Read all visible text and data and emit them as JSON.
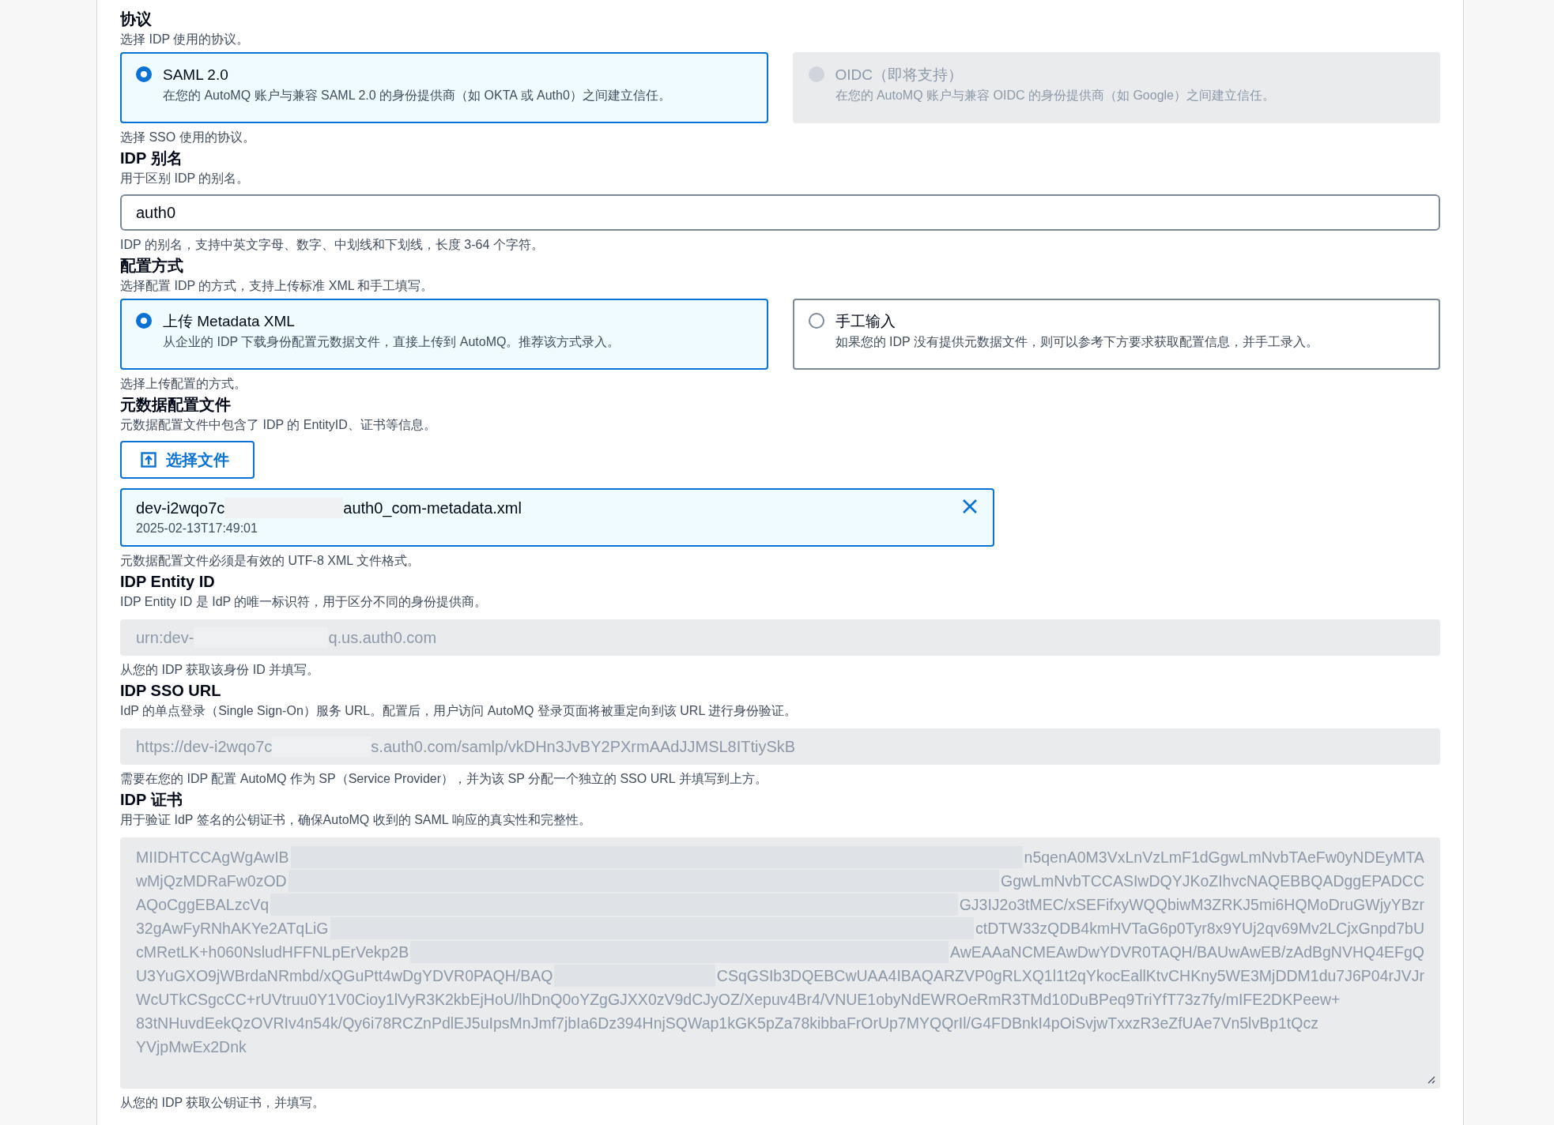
{
  "sections": [
    {
      "kind": "radio",
      "title": "协议",
      "description": "选择 IDP 使用的协议。",
      "options": [
        {
          "label": "SAML 2.0",
          "detail": "在您的 AutoMQ 账户与兼容 SAML 2.0 的身份提供商（如 OKTA 或 Auth0）之间建立信任。",
          "selected": true,
          "disabled": false
        },
        {
          "label": "OIDC（即将支持）",
          "detail": "在您的 AutoMQ 账户与兼容 OIDC 的身份提供商（如 Google）之间建立信任。",
          "selected": false,
          "disabled": true
        }
      ],
      "hint": "选择 SSO 使用的协议。"
    },
    {
      "kind": "input",
      "title": "IDP 别名",
      "description": "用于区别 IDP 的别名。",
      "value": "auth0",
      "hint": "IDP 的别名，支持中英文字母、数字、中划线和下划线，长度 3-64 个字符。"
    },
    {
      "kind": "radio",
      "title": "配置方式",
      "description": "选择配置 IDP 的方式，支持上传标准 XML 和手工填写。",
      "options": [
        {
          "label": "上传 Metadata XML",
          "detail": "从企业的 IDP 下载身份配置元数据文件，直接上传到 AutoMQ。推荐该方式录入。",
          "selected": true,
          "disabled": false
        },
        {
          "label": "手工输入",
          "detail": "如果您的 IDP 没有提供元数据文件，则可以参考下方要求获取配置信息，并手工录入。",
          "selected": false,
          "disabled": false
        }
      ],
      "hint": "选择上传配置的方式。"
    },
    {
      "kind": "file",
      "title": "元数据配置文件",
      "description": "元数据配置文件中包含了 IDP 的 EntityID、证书等信息。",
      "button": "选择文件",
      "file": {
        "before": "dev-i2wqo7c",
        "after": "auth0_com-metadata.xml",
        "date": "2025-02-13T17:49:01"
      },
      "hint": "元数据配置文件必须是有效的 UTF-8 XML 文件格式。"
    },
    {
      "kind": "readonly",
      "title": "IDP Entity ID",
      "description": "IDP Entity ID 是 IdP 的唯一标识符，用于区分不同的身份提供商。",
      "before": "urn:dev-",
      "after": "q.us.auth0.com",
      "hint": "从您的 IDP 获取该身份 ID 并填写。"
    },
    {
      "kind": "readonly",
      "title": "IDP SSO URL",
      "description": "IdP 的单点登录（Single Sign-On）服务 URL。配置后，用户访问 AutoMQ 登录页面将被重定向到该 URL 进行身份验证。",
      "before": "https://dev-i2wqo7c",
      "after": "s.auth0.com/samlp/vkDHn3JvBY2PXrmAAdJJMSL8ITtiySkB",
      "hint": "需要在您的 IDP 配置 AutoMQ 作为 SP（Service Provider），并为该 SP 分配一个独立的 SSO URL 并填写到上方。"
    },
    {
      "kind": "cert",
      "title": "IDP 证书",
      "description": "用于验证 IdP 签名的公钥证书，确保AutoMQ 收到的 SAML 响应的真实性和完整性。",
      "lines": [
        {
          "before": "MIIDHTCCAgWgAwIB",
          "after": "n5qenA0M3VxLnVzLmF1dGgwLmNvbTAeFw0yNDEyMTA"
        },
        {
          "before": "wMjQzMDRaFw0zOD",
          "after": "GgwLmNvbTCCASIwDQYJKoZIhvcNAQEBBQADggEPADCC"
        },
        {
          "before": "AQoCggEBALzcVq",
          "after": "GJ3IJ2o3tMEC/xSEFifxyWQQbiwM3ZRKJ5mi6HQMoDruGWjyYBzr"
        },
        {
          "before": "32gAwFyRNhAKYe2ATqLiG",
          "after": "ctDTW33zQDB4kmHVTaG6p0Tyr8x9YUj2qv69Mv2LCjxGnpd7bU"
        },
        {
          "before": "cMRetLK+h060NsludHFFNLpErVekp2B",
          "after": "AwEAAaNCMEAwDwYDVR0TAQH/BAUwAwEB/zAdBgNVHQ4EFgQ"
        },
        {
          "before": "U3YuGXO9jWBrdaNRmbd/xQGuPtt4wDgYDVR0PAQH/BAQ",
          "after": "CSqGSIb3DQEBCwUAA4IBAQARZVP0gRLXQ1l1t2qYkocEallKtvCHKny5WE3MjDDM1du7J6P04rJVJr"
        },
        {
          "before": "WcUTkCSgcCC+rUVtruu0Y1V0Cioy1lVyR3K2kbEjHoU/lhDnQ0oYZgGJXX0zV9dCJyOZ/Xepuv4Br4/VNUE1obyNdEWROeRmR3TMd10DuBPeq9TriYfT73z7fy/mIFE2DKPeew+"
        },
        {
          "before": "83tNHuvdEekQzOVRIv4n54k/Qy6i78RCZnPdlEJ5uIpsMnJmf7jbIa6Dz394HnjSQWap1kGK5pZa78kibbaFrOrUp7MYQQrIl/G4FDBnkI4pOiSvjwTxxzR3eZfUAe7Vn5lvBp1tQcz"
        },
        {
          "before": "YVjpMwEx2Dnk"
        }
      ],
      "hint": "从您的 IDP 获取公钥证书，并填写。"
    }
  ]
}
